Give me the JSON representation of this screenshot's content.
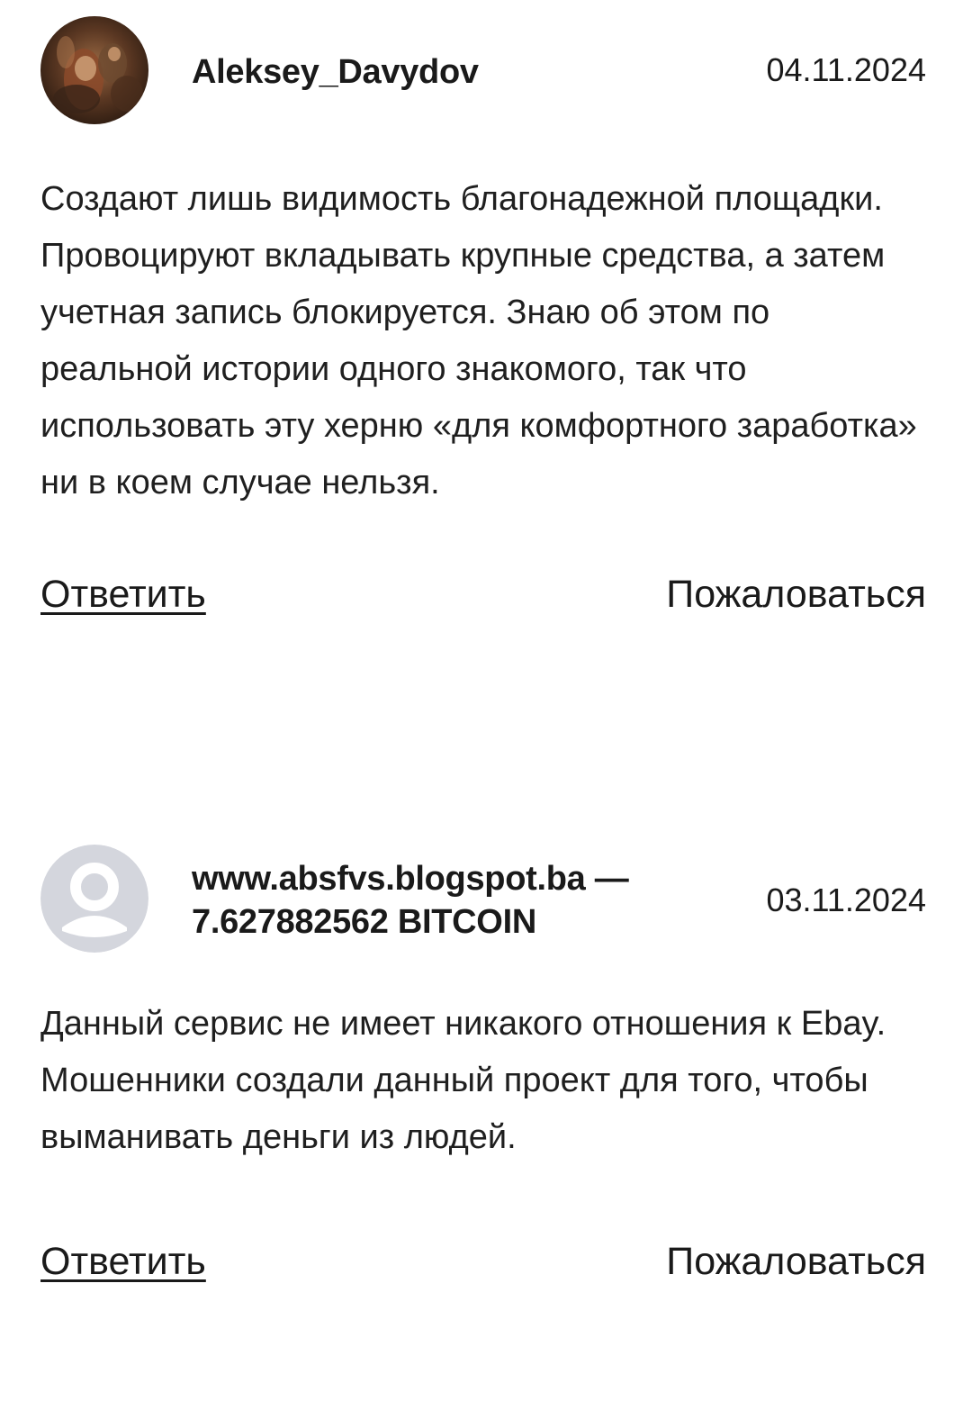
{
  "comments": [
    {
      "author": "Aleksey_Davydov",
      "date": "04.11.2024",
      "text": "Создают лишь видимость благонадежной площадки. Провоцируют вкладывать крупные средства, а затем учетная запись блокируется. Знаю об этом по реальной истории одного знакомого, так что использовать эту херню «для комфортного заработка» ни в коем случае нельзя.",
      "reply_label": "Ответить",
      "report_label": "Пожаловаться",
      "avatar": "painting-avatar"
    },
    {
      "author": "www.absfvs.blogspot.ba — 7.627882562 BITCOIN",
      "date": "03.11.2024",
      "text": "Данный сервис не имеет никакого отношения к Ebay. Мошенники создали данный проект для того, чтобы выманивать деньги из людей.",
      "reply_label": "Ответить",
      "report_label": "Пожаловаться",
      "avatar": "default-user-avatar"
    }
  ],
  "colors": {
    "text": "#1a1a1a",
    "placeholder_avatar_bg": "#d4d6dd",
    "placeholder_avatar_fg": "#ffffff"
  }
}
